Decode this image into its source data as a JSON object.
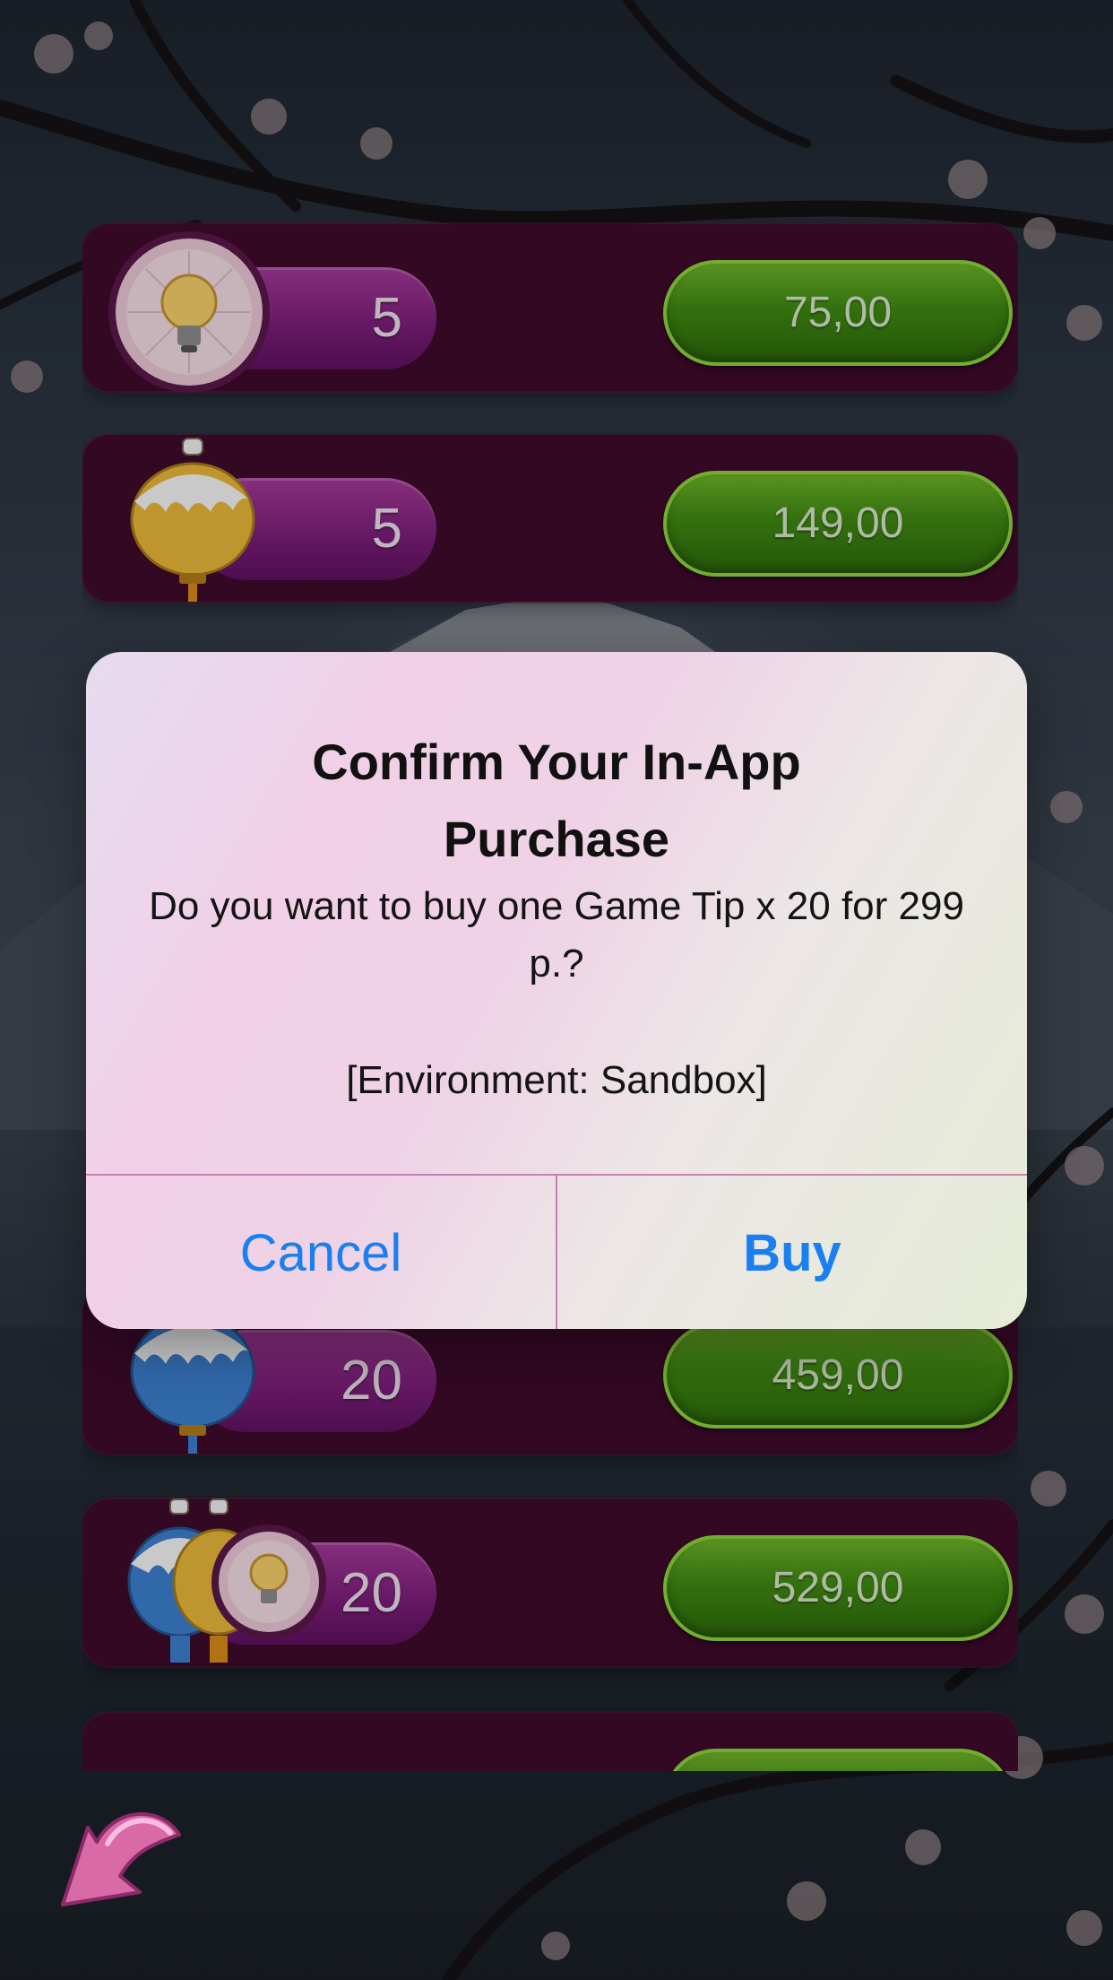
{
  "store": {
    "rows": [
      {
        "icon": "lightbulb-icon",
        "count": "5",
        "price": "75,00"
      },
      {
        "icon": "lantern-gold-icon",
        "count": "5",
        "price": "149,00"
      },
      {
        "icon": "lantern-blue-icon",
        "count": "20",
        "price": "459,00"
      },
      {
        "icon": "lantern-lightbulb-combo-icon",
        "count": "20",
        "price": "529,00"
      }
    ]
  },
  "alert": {
    "title": "Confirm Your In-App Purchase",
    "message": "Do you want to buy one Game Tip x 20 for 299 р.?",
    "environment": "[Environment: Sandbox]",
    "cancel_label": "Cancel",
    "buy_label": "Buy"
  },
  "colors": {
    "row_bg": "#3e0a2b",
    "price_button": "#3f8a12",
    "count_pill": "#7e1e7b",
    "alert_button_text": "#1a7ff0"
  },
  "back_button": {
    "icon": "back-arrow-icon"
  }
}
